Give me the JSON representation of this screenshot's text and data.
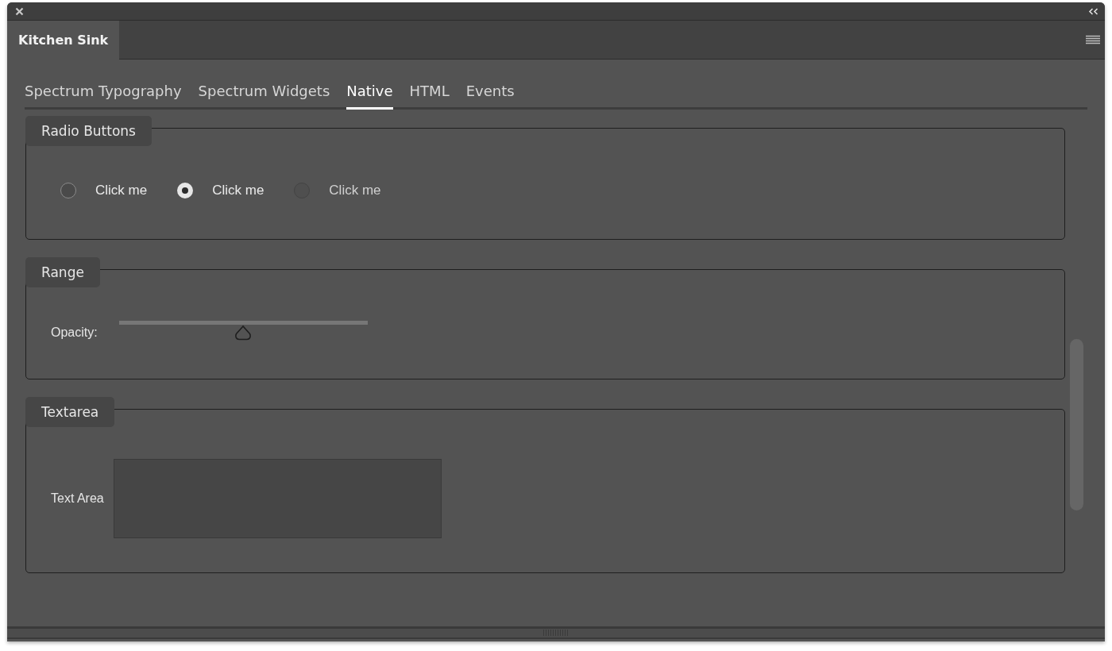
{
  "panel": {
    "title": "Kitchen Sink"
  },
  "tabs": [
    {
      "label": "Spectrum Typography",
      "selected": false
    },
    {
      "label": "Spectrum Widgets",
      "selected": false
    },
    {
      "label": "Native",
      "selected": true
    },
    {
      "label": "HTML",
      "selected": false
    },
    {
      "label": "Events",
      "selected": false
    }
  ],
  "sections": [
    {
      "kind": "radios",
      "legend": "Radio Buttons",
      "radios": [
        {
          "label": "Click me",
          "selected": false,
          "disabled": false
        },
        {
          "label": "Click me",
          "selected": true,
          "disabled": false
        },
        {
          "label": "Click me",
          "selected": false,
          "disabled": true
        }
      ]
    },
    {
      "kind": "range",
      "legend": "Range",
      "label": "Opacity:",
      "level": 0.5
    },
    {
      "kind": "textarea",
      "legend": "Textarea",
      "label": "Text Area"
    }
  ]
}
